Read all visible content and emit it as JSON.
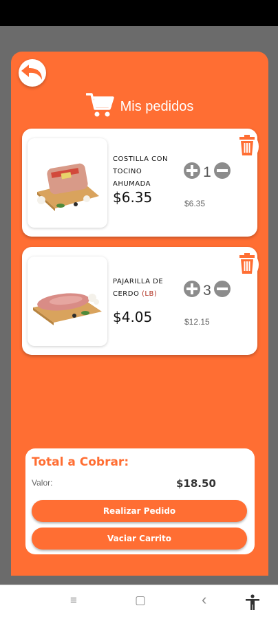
{
  "header": {
    "title": "Mis pedidos"
  },
  "items": [
    {
      "name": "COSTILLA CON TOCINO AHUMADA",
      "price": "$6.35",
      "quantity": "1",
      "subtotal": "$6.35"
    },
    {
      "name_main": "PAJARILLA DE CERDO ",
      "name_unit": "(LB)",
      "price": "$4.05",
      "quantity": "3",
      "subtotal": "$12.15"
    }
  ],
  "summary": {
    "title": "Total a Cobrar:",
    "valor_label": "Valor:",
    "valor_amount": "$18.50",
    "order_button": "Realizar Pedido",
    "clear_button": "Vaciar Carrito"
  },
  "colors": {
    "accent": "#ff6e33",
    "background": "#6b6b6b",
    "unit_text": "#b03020"
  },
  "navbar": {
    "menu_glyph": "≡",
    "home_glyph": "▢",
    "back_glyph": "‹"
  }
}
